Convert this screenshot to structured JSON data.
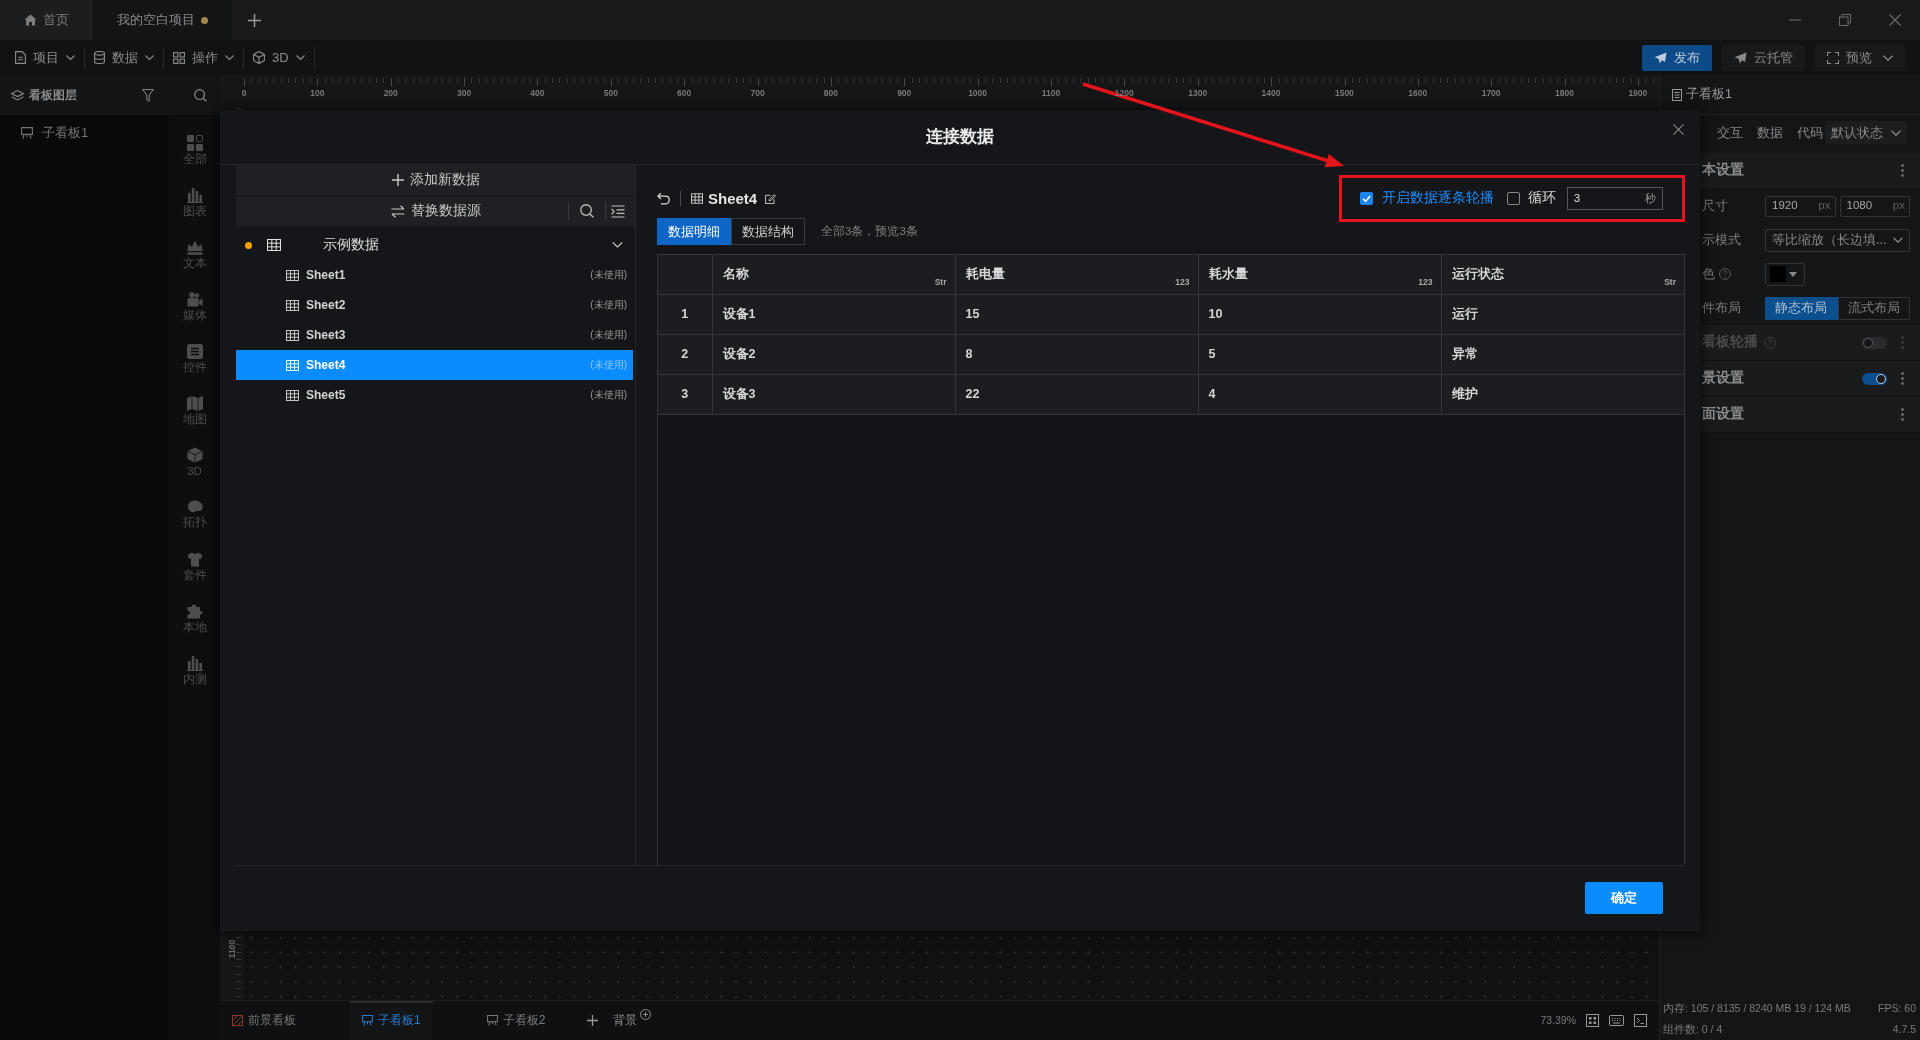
{
  "app_tabs": [
    {
      "label": "首页",
      "kind": "home",
      "selected": false,
      "unsaved": false
    },
    {
      "label": "我的空白项目",
      "kind": "project",
      "selected": true,
      "unsaved": true
    }
  ],
  "menus": [
    {
      "label": "项目"
    },
    {
      "label": "数据"
    },
    {
      "label": "操作"
    },
    {
      "label": "3D"
    }
  ],
  "publish_bar": [
    {
      "label": "发布",
      "kind": "primary"
    },
    {
      "label": "云托管",
      "kind": "plain"
    },
    {
      "label": "预览",
      "kind": "menu"
    }
  ],
  "layers_panel": {
    "title": "看板图层",
    "items": [
      {
        "label": "子看板1"
      }
    ]
  },
  "component_categories": [
    {
      "label": "全部"
    },
    {
      "label": "图表"
    },
    {
      "label": "文本"
    },
    {
      "label": "媒体"
    },
    {
      "label": "控件"
    },
    {
      "label": "地图"
    },
    {
      "label": "3D"
    },
    {
      "label": "拓扑"
    },
    {
      "label": "套件"
    },
    {
      "label": "本地"
    },
    {
      "label": "内测"
    }
  ],
  "ruler": {
    "labels": [
      "0",
      "100",
      "200",
      "300",
      "400",
      "500",
      "600",
      "700",
      "800",
      "900",
      "1000",
      "1100",
      "1200",
      "1300",
      "1400",
      "1500",
      "1600",
      "1700",
      "1800",
      "1900"
    ],
    "vertical_label": "1100"
  },
  "dialog": {
    "title": "连接数据",
    "actions": [
      {
        "label": "添加新数据",
        "kind": "add"
      },
      {
        "label": "替换数据源",
        "kind": "replace"
      }
    ],
    "source": {
      "name": "示例数据",
      "expanded": true,
      "sheets": [
        {
          "name": "Sheet1",
          "status": "(未使用)",
          "selected": false
        },
        {
          "name": "Sheet2",
          "status": "(未使用)",
          "selected": false
        },
        {
          "name": "Sheet3",
          "status": "(未使用)",
          "selected": false
        },
        {
          "name": "Sheet4",
          "status": "(未使用)",
          "selected": true
        },
        {
          "name": "Sheet5",
          "status": "(未使用)",
          "selected": false
        }
      ]
    },
    "sheet_title": "Sheet4",
    "carousel_options": {
      "highlighted": true,
      "carousel": {
        "label": "开启数据逐条轮播",
        "checked": true
      },
      "loop": {
        "label": "循环",
        "checked": false
      },
      "interval": {
        "value": "3",
        "unit": "秒"
      }
    },
    "view_tabs": [
      {
        "label": "数据明细",
        "selected": true
      },
      {
        "label": "数据结构",
        "selected": false
      }
    ],
    "summary": "全部3条，预览3条",
    "table": {
      "columns": [
        {
          "label": "名称",
          "type": "Str"
        },
        {
          "label": "耗电量",
          "type": "123"
        },
        {
          "label": "耗水量",
          "type": "123"
        },
        {
          "label": "运行状态",
          "type": "Str"
        }
      ],
      "rows": [
        {
          "index": "1",
          "cells": [
            "设备1",
            "15",
            "10",
            "运行"
          ]
        },
        {
          "index": "2",
          "cells": [
            "设备2",
            "8",
            "5",
            "异常"
          ]
        },
        {
          "index": "3",
          "cells": [
            "设备3",
            "22",
            "4",
            "维护"
          ]
        }
      ]
    },
    "confirm": "确定"
  },
  "bottom_bar": {
    "tabs": [
      {
        "label": "前景看板",
        "kind": "foreground",
        "selected": false
      },
      {
        "label": "子看板1",
        "kind": "board",
        "selected": true
      },
      {
        "label": "子看板2",
        "kind": "board",
        "selected": false
      }
    ],
    "background_label": "背景",
    "zoom": "73.39%"
  },
  "properties_panel": {
    "title": "子看板1",
    "tabs": [
      {
        "label": "交互",
        "selected": false
      },
      {
        "label": "数据",
        "selected": false
      },
      {
        "label": "代码",
        "selected": false
      }
    ],
    "state_select": "默认状态",
    "sections": [
      {
        "kind": "section",
        "label": "本设置",
        "disabled": false
      },
      {
        "kind": "size",
        "label": "尺寸",
        "width": {
          "value": "1920",
          "unit": "px"
        },
        "height": {
          "value": "1080",
          "unit": "px"
        }
      },
      {
        "kind": "select",
        "label": "示模式",
        "value": "等比缩放（长边填..."
      },
      {
        "kind": "color",
        "label": "色",
        "help": true,
        "color": "#000000"
      },
      {
        "kind": "segmented",
        "label": "件布局",
        "options": [
          {
            "label": "静态布局",
            "selected": true
          },
          {
            "label": "流式布局",
            "selected": false
          }
        ]
      },
      {
        "kind": "section",
        "label": "看板轮播",
        "disabled": true,
        "help": true,
        "toggle": {
          "on": false
        }
      },
      {
        "kind": "section",
        "label": "景设置",
        "disabled": false,
        "toggle": {
          "on": true
        }
      },
      {
        "kind": "section",
        "label": "面设置",
        "disabled": false
      }
    ]
  },
  "status_bar": {
    "memory": "内存: 105 / 8135 / 8240 MB 19 / 124 MB",
    "fps": "FPS: 60",
    "components": "组件数: 0 / 4",
    "version": "4.7.5"
  }
}
